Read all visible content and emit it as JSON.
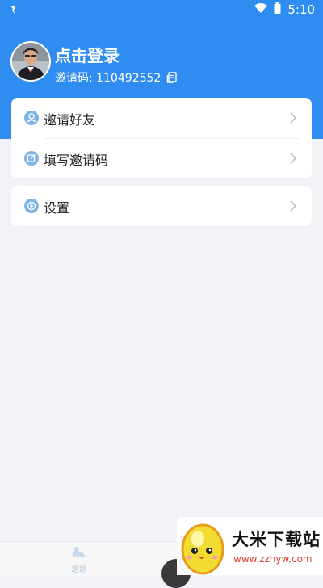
{
  "status_bar": {
    "time": "5:10",
    "wifi_icon": "wifi-icon",
    "battery_icon": "battery-icon",
    "notification_icon": "notification-icon"
  },
  "profile": {
    "title": "点击登录",
    "invite_label": "邀请码: 110492552",
    "avatar_icon": "avatar",
    "copy_icon": "copy-icon"
  },
  "menu": {
    "items": [
      {
        "label": "邀请好友",
        "icon": "user-icon"
      },
      {
        "label": "填写邀请码",
        "icon": "edit-icon"
      }
    ],
    "settings": {
      "label": "设置",
      "icon": "settings-icon"
    }
  },
  "tabbar": {
    "walk_label": "走路",
    "walk_icon": "shoe-icon"
  },
  "watermark": {
    "name": "大米下载站",
    "url": "www.zzhyw.com"
  },
  "colors": {
    "accent": "#2f8cf0",
    "background": "#f0f2f5",
    "icon": "#7eb3e6",
    "url": "#e23a2a"
  }
}
